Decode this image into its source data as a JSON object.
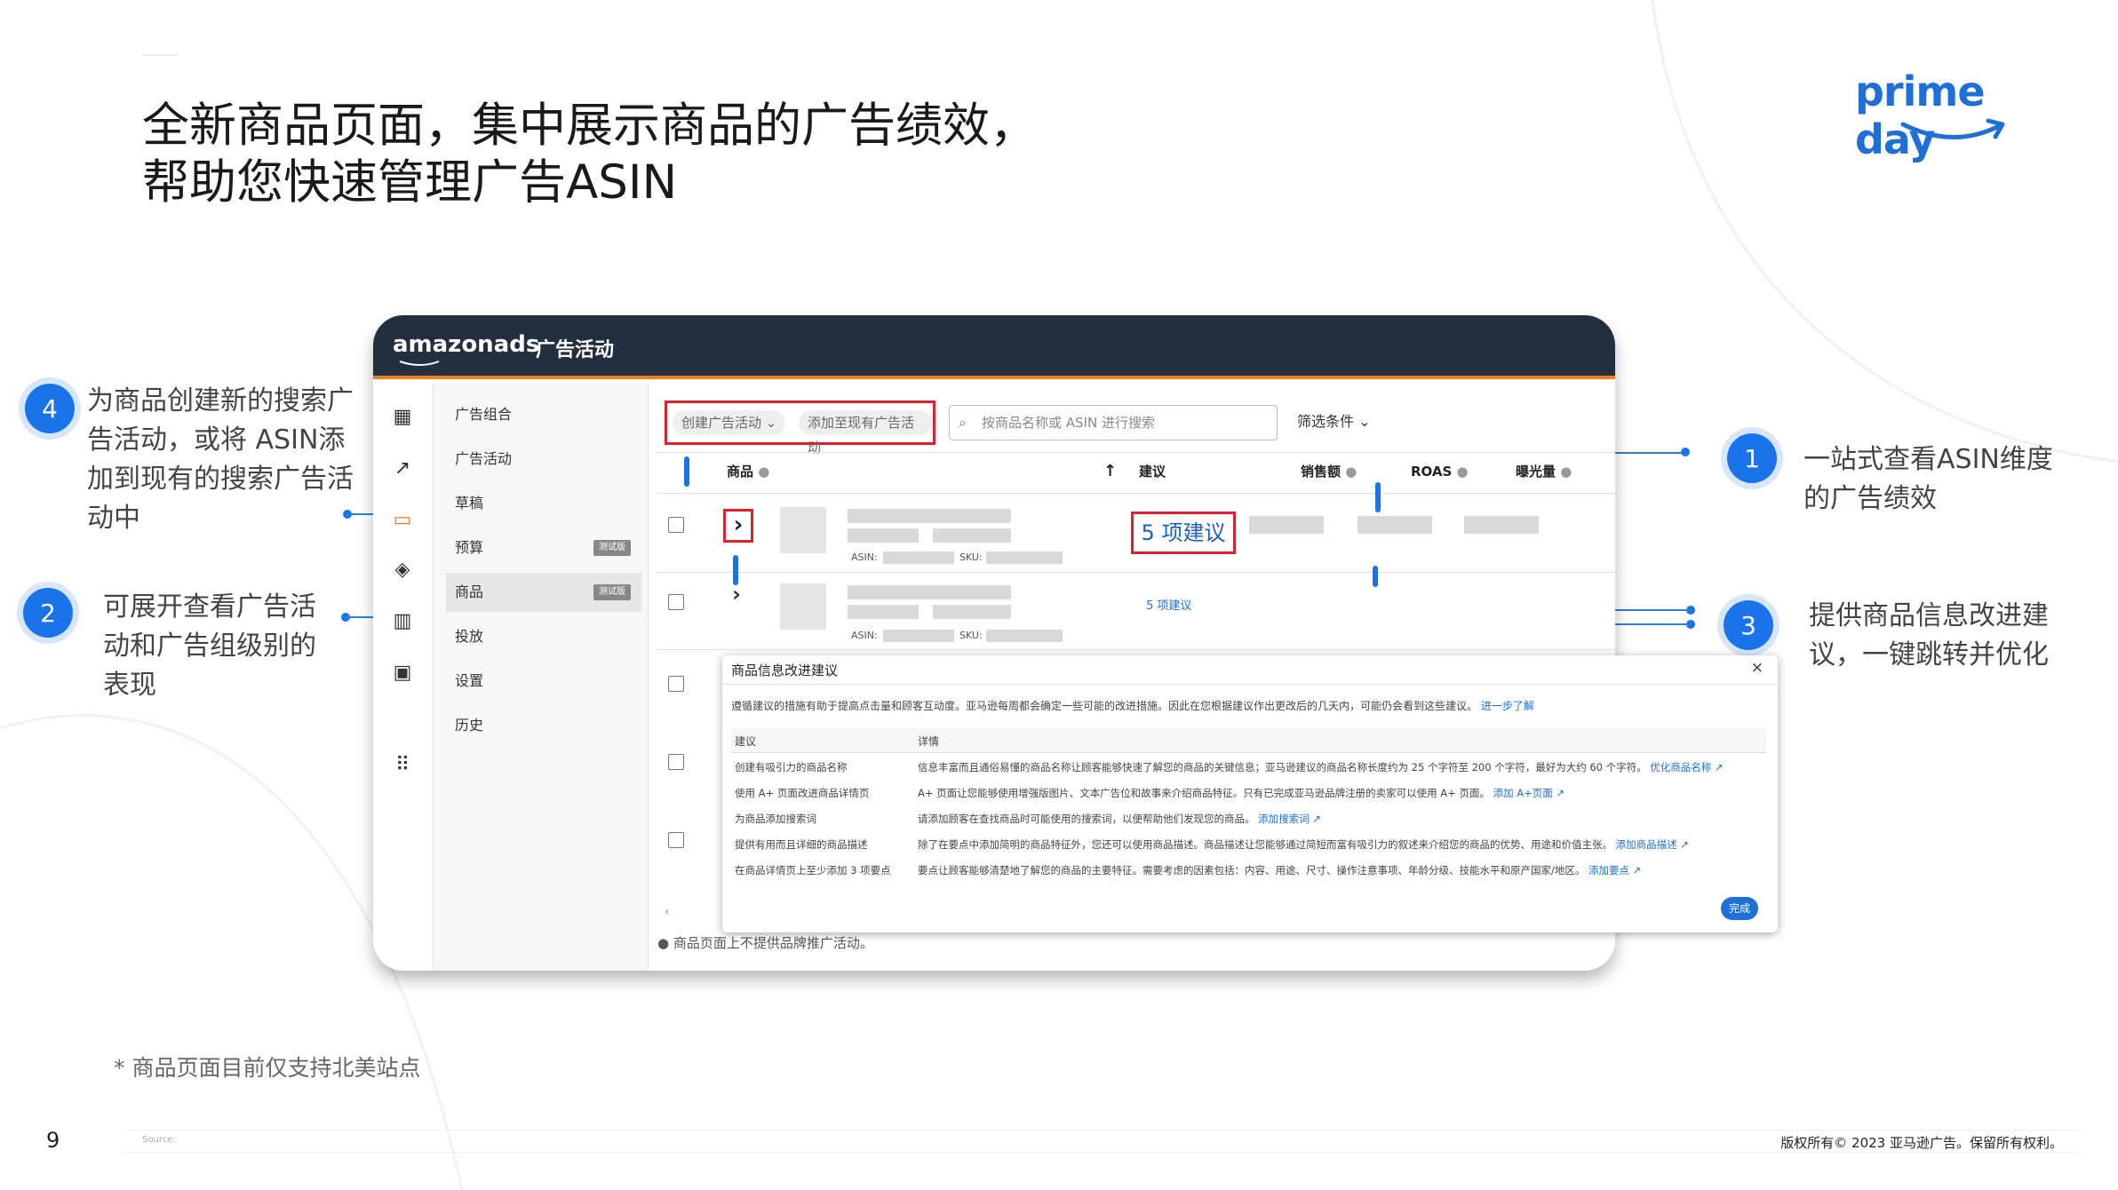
{
  "title": {
    "line1": "全新商品页面，集中展示商品的广告绩效，",
    "line2": "帮助您快速管理广告ASIN"
  },
  "logo": {
    "text": "prime day",
    "color": "#1f6fd6"
  },
  "callouts": [
    {
      "number": "1",
      "text": "一站式查看ASIN维度的广告绩效"
    },
    {
      "number": "2",
      "text": "可展开查看广告活动和广告组级别的表现"
    },
    {
      "number": "3",
      "text": "提供商品信息改进建议，一键跳转并优化"
    },
    {
      "number": "4",
      "text": "为商品创建新的搜索广告活动，或将 ASIN添加到现有的搜索广告活动中"
    }
  ],
  "app": {
    "brand": "amazonads",
    "nav_title": "广告活动",
    "menu": [
      {
        "label": "广告组合",
        "badge": ""
      },
      {
        "label": "广告活动",
        "badge": ""
      },
      {
        "label": "草稿",
        "badge": ""
      },
      {
        "label": "预算",
        "badge": "测试版"
      },
      {
        "label": "商品",
        "badge": "测试版"
      },
      {
        "label": "投放",
        "badge": ""
      },
      {
        "label": "设置",
        "badge": ""
      },
      {
        "label": "历史",
        "badge": ""
      }
    ],
    "toolbar": {
      "create_campaign": "创建广告活动",
      "add_existing": "添加至现有广告活动",
      "search_placeholder": "按商品名称或 ASIN 进行搜索",
      "filter": "筛选条件"
    },
    "columns": [
      "商品",
      "建议",
      "销售额",
      "ROAS",
      "曝光量"
    ],
    "rows": [
      {
        "asin_label": "ASIN:",
        "sku_label": "SKU:",
        "suggestion": "5 项建议"
      },
      {
        "asin_label": "ASIN:",
        "sku_label": "SKU:",
        "suggestion": "5 项建议"
      }
    ],
    "notice": "商品页面上不提供品牌推广活动。"
  },
  "popup": {
    "title": "商品信息改进建议",
    "close": "×",
    "intro": "遵循建议的措施有助于提高点击量和顾客互动度。亚马逊每周都会确定一些可能的改进措施。因此在您根据建议作出更改后的几天内，可能仍会看到这些建议。",
    "intro_link": "进一步了解",
    "col_suggestion": "建议",
    "col_detail": "详情",
    "rows": [
      {
        "suggestion": "创建有吸引力的商品名称",
        "detail": "信息丰富而且通俗易懂的商品名称让顾客能够快速了解您的商品的关键信息；亚马逊建议的商品名称长度约为 25 个字符至 200 个字符，最好为大约 60 个字符。",
        "link": "优化商品名称"
      },
      {
        "suggestion": "使用 A+ 页面改进商品详情页",
        "detail": "A+ 页面让您能够使用增强版图片、文本广告位和故事来介绍商品特征。只有已完成亚马逊品牌注册的卖家可以使用 A+ 页面。",
        "link": "添加 A+页面"
      },
      {
        "suggestion": "为商品添加搜索词",
        "detail": "请添加顾客在查找商品时可能使用的搜索词，以便帮助他们发现您的商品。",
        "link": "添加搜索词"
      },
      {
        "suggestion": "提供有用而且详细的商品描述",
        "detail": "除了在要点中添加简明的商品特征外，您还可以使用商品描述。商品描述让您能够通过简短而富有吸引力的叙述来介绍您的商品的优势、用途和价值主张。",
        "link": "添加商品描述"
      },
      {
        "suggestion": "在商品详情页上至少添加 3 项要点",
        "detail": "要点让顾客能够清楚地了解您的商品的主要特征。需要考虑的因素包括：内容、用途、尺寸、操作注意事项、年龄分级、技能水平和原产国家/地区。",
        "link": "添加要点"
      }
    ],
    "done": "完成"
  },
  "footnote": "* 商品页面目前仅支持北美站点",
  "page_number": "9",
  "source": "Source:",
  "copyright": "版权所有© 2023 亚马逊广告。保留所有权利。"
}
